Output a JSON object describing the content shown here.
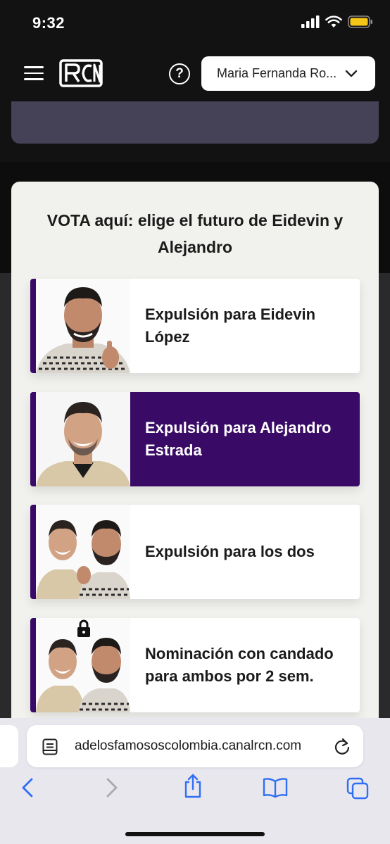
{
  "status_bar": {
    "time": "9:32",
    "icons": [
      "cellular-signal-icon",
      "wifi-icon",
      "battery-icon"
    ],
    "battery_color": "#f5c518"
  },
  "nav": {
    "menu_icon": "hamburger-menu-icon",
    "logo_text": "RCN",
    "help_icon": "help-circle-icon",
    "user_name": "Maria Fernanda Ro...",
    "chevron": "chevron-down-icon"
  },
  "vote": {
    "title": "VOTA aquí: elige el futuro de Eidevin y Alejandro",
    "accent_color": "#3a0b66",
    "options": [
      {
        "label": "Expulsión para Eidevin López",
        "selected": false
      },
      {
        "label": "Expulsión para Alejandro Estrada",
        "selected": true
      },
      {
        "label": "Expulsión para los dos",
        "selected": false
      },
      {
        "label": "Nominación con candado para ambos por 2 sem.",
        "selected": false,
        "badge": "lock-icon"
      }
    ]
  },
  "browser": {
    "url": "adelosfamososcolombia.canalrcn.com",
    "toolbar_icons": [
      "back-icon",
      "forward-icon",
      "share-icon",
      "bookmarks-icon",
      "tabs-icon"
    ],
    "tint_color": "#2f6ff5"
  }
}
